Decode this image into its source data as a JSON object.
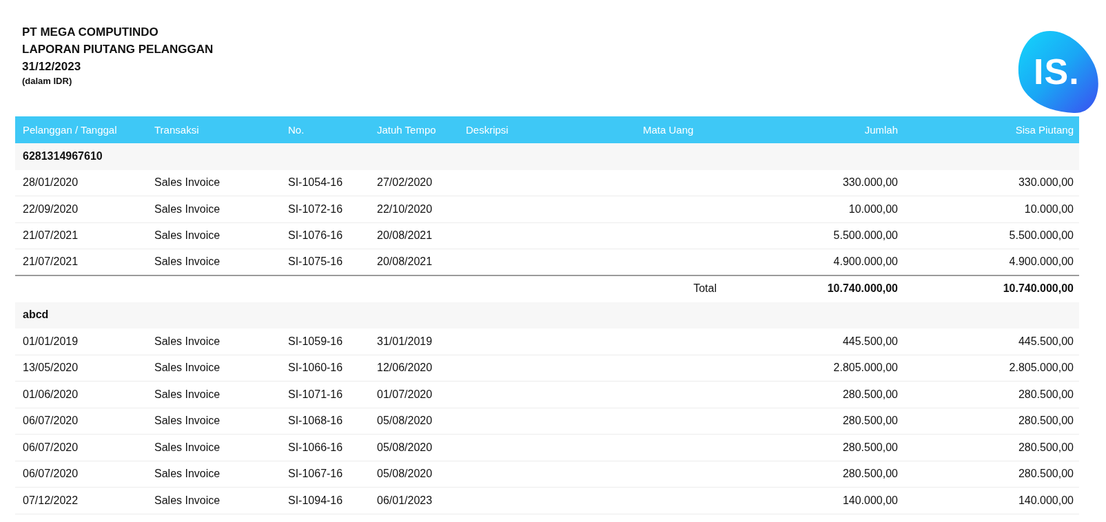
{
  "header": {
    "company": "PT MEGA COMPUTINDO",
    "title": "LAPORAN PIUTANG PELANGGAN",
    "date": "31/12/2023",
    "currency_note": "(dalam IDR)",
    "logo_text": "IS."
  },
  "table": {
    "columns": [
      "Pelanggan / Tanggal",
      "Transaksi",
      "No.",
      "Jatuh Tempo",
      "Deskripsi",
      "Mata Uang",
      "Jumlah",
      "Sisa Piutang"
    ],
    "groups": [
      {
        "customer": "6281314967610",
        "rows": [
          {
            "date": "28/01/2020",
            "transaction": "Sales Invoice",
            "number": "SI-1054-16",
            "due_date": "27/02/2020",
            "amount": "330.000,00",
            "balance": "330.000,00"
          },
          {
            "date": "22/09/2020",
            "transaction": "Sales Invoice",
            "number": "SI-1072-16",
            "due_date": "22/10/2020",
            "amount": "10.000,00",
            "balance": "10.000,00"
          },
          {
            "date": "21/07/2021",
            "transaction": "Sales Invoice",
            "number": "SI-1076-16",
            "due_date": "20/08/2021",
            "amount": "5.500.000,00",
            "balance": "5.500.000,00"
          },
          {
            "date": "21/07/2021",
            "transaction": "Sales Invoice",
            "number": "SI-1075-16",
            "due_date": "20/08/2021",
            "amount": "4.900.000,00",
            "balance": "4.900.000,00"
          }
        ],
        "total": {
          "label": "Total",
          "amount": "10.740.000,00",
          "balance": "10.740.000,00"
        }
      },
      {
        "customer": "abcd",
        "rows": [
          {
            "date": "01/01/2019",
            "transaction": "Sales Invoice",
            "number": "SI-1059-16",
            "due_date": "31/01/2019",
            "amount": "445.500,00",
            "balance": "445.500,00"
          },
          {
            "date": "13/05/2020",
            "transaction": "Sales Invoice",
            "number": "SI-1060-16",
            "due_date": "12/06/2020",
            "amount": "2.805.000,00",
            "balance": "2.805.000,00"
          },
          {
            "date": "01/06/2020",
            "transaction": "Sales Invoice",
            "number": "SI-1071-16",
            "due_date": "01/07/2020",
            "amount": "280.500,00",
            "balance": "280.500,00"
          },
          {
            "date": "06/07/2020",
            "transaction": "Sales Invoice",
            "number": "SI-1068-16",
            "due_date": "05/08/2020",
            "amount": "280.500,00",
            "balance": "280.500,00"
          },
          {
            "date": "06/07/2020",
            "transaction": "Sales Invoice",
            "number": "SI-1066-16",
            "due_date": "05/08/2020",
            "amount": "280.500,00",
            "balance": "280.500,00"
          },
          {
            "date": "06/07/2020",
            "transaction": "Sales Invoice",
            "number": "SI-1067-16",
            "due_date": "05/08/2020",
            "amount": "280.500,00",
            "balance": "280.500,00"
          },
          {
            "date": "07/12/2022",
            "transaction": "Sales Invoice",
            "number": "SI-1094-16",
            "due_date": "06/01/2023",
            "amount": "140.000,00",
            "balance": "140.000,00"
          }
        ]
      }
    ]
  }
}
